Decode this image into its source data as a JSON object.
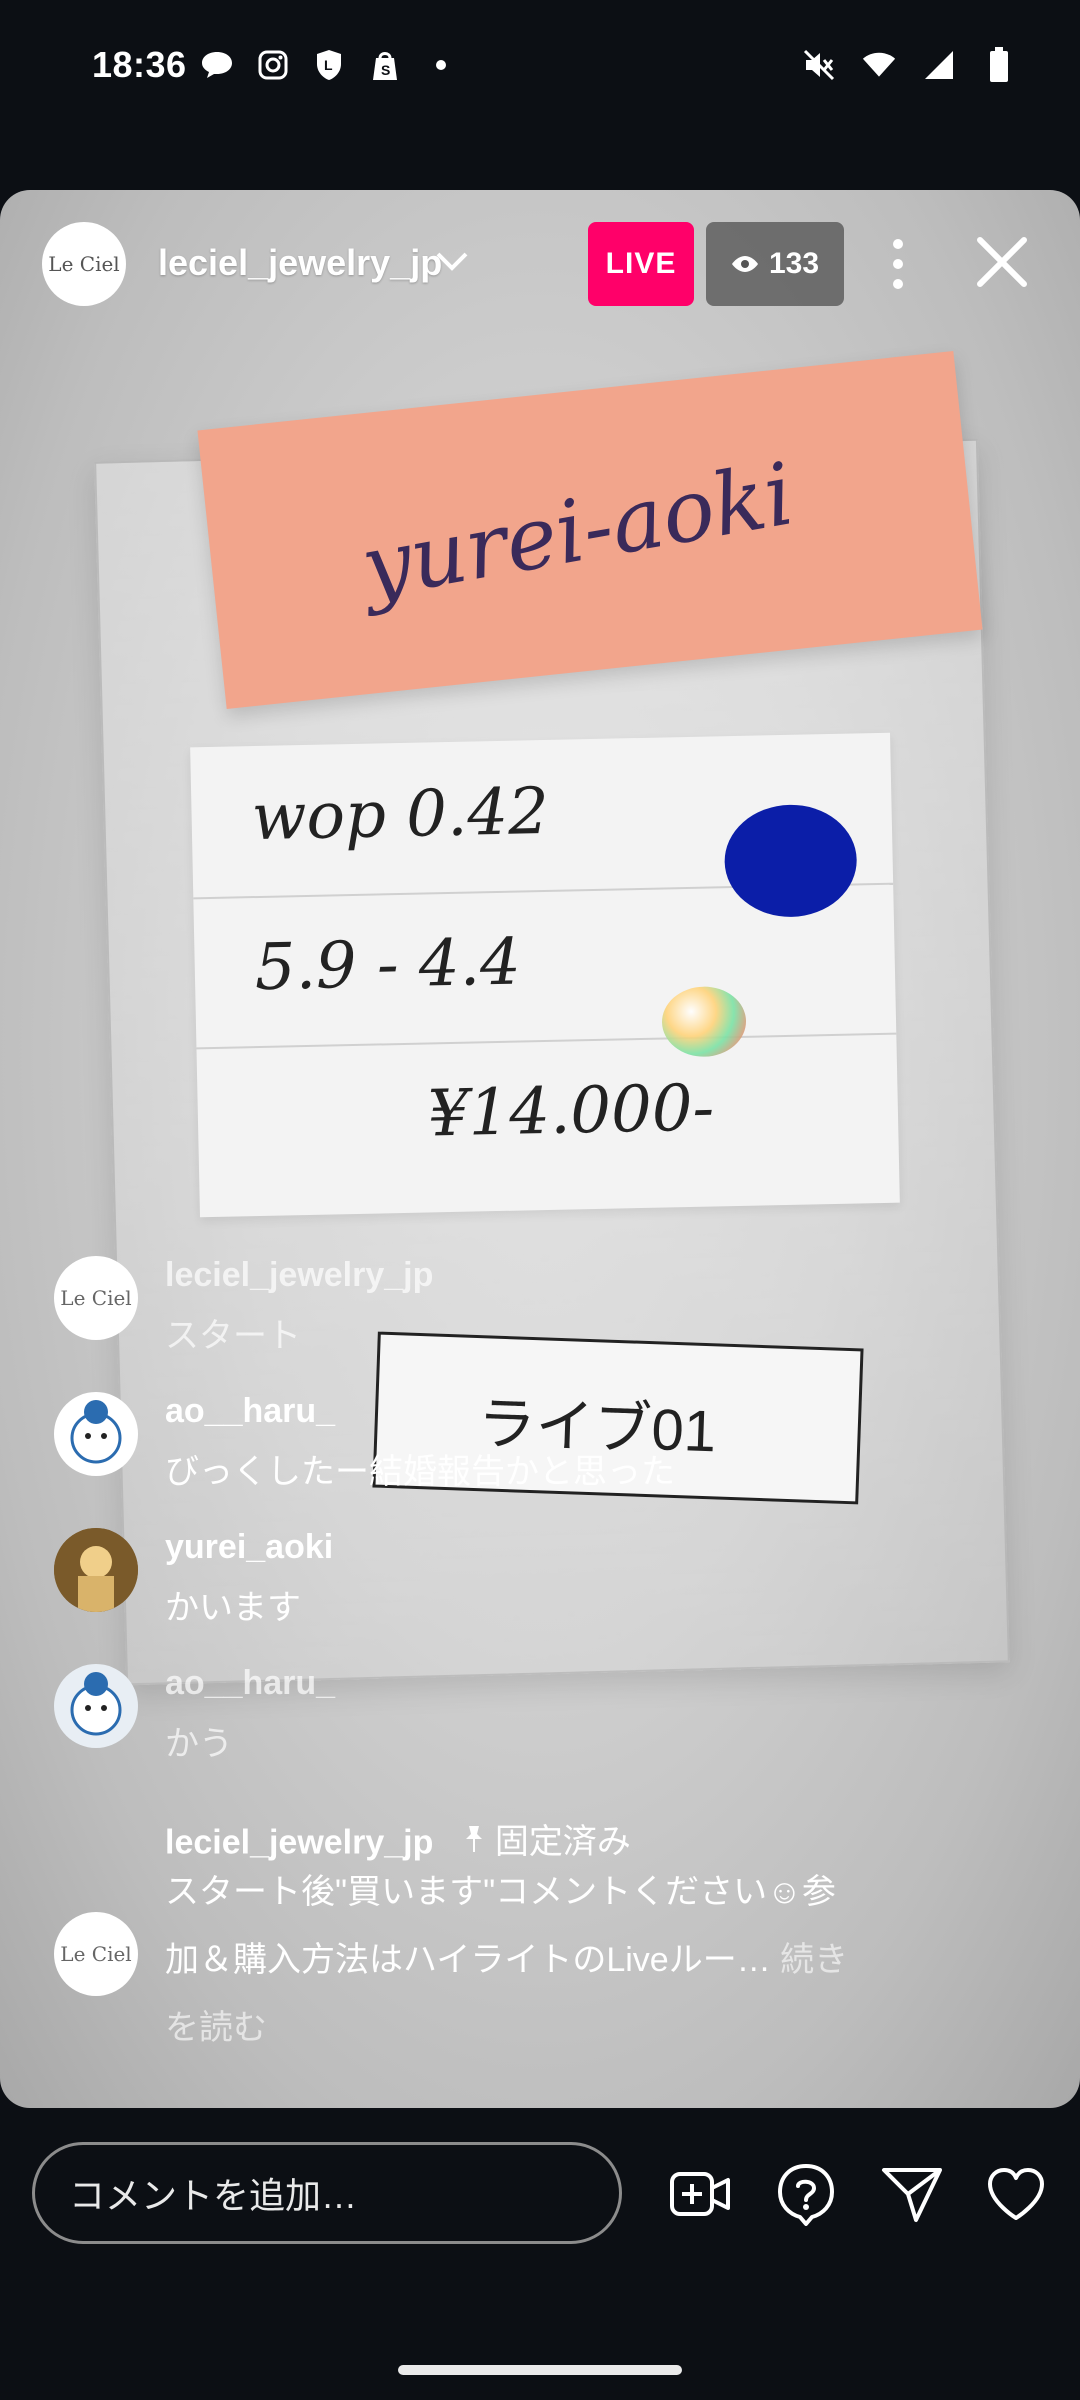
{
  "status_bar": {
    "time": "18:36",
    "left_icons": [
      "chat-bubble-icon",
      "instagram-icon",
      "line-icon",
      "shopify-bag-icon",
      "dot-icon"
    ],
    "right_icons": [
      "mute-icon",
      "wifi-icon",
      "signal-icon",
      "battery-icon"
    ]
  },
  "header": {
    "account_name": "leciel_jewelry_jp",
    "avatar_text": "Le Ciel",
    "live_label": "LIVE",
    "viewer_count": "133"
  },
  "video": {
    "sticky_note_text": "yurei-aoki",
    "card_rows": [
      "wop 0.42",
      "5.9 - 4.4",
      "¥14.000-"
    ],
    "label_text": "ライブ01"
  },
  "comments": [
    {
      "user": "leciel_jewelry_jp",
      "text": "スタート",
      "avatar": "Le Ciel"
    },
    {
      "user": "ao__haru_",
      "text": "びっくしたー結婚報告かと思った",
      "avatar": ""
    },
    {
      "user": "yurei_aoki",
      "text": "かいます",
      "avatar": ""
    },
    {
      "user": "ao__haru_",
      "text": "かう",
      "avatar": ""
    }
  ],
  "pinned": {
    "user": "leciel_jewelry_jp",
    "pin_label": "固定済み",
    "line1": "スタート後\"買います\"コメントください☺参",
    "line2": "加＆購入方法はハイライトのLiveルー…",
    "more1": "続き",
    "more2": "を読む",
    "avatar": "Le Ciel"
  },
  "bottom_bar": {
    "comment_placeholder": "コメントを追加…"
  },
  "colors": {
    "live_badge": "#ff0069",
    "background": "#0c0f14"
  }
}
